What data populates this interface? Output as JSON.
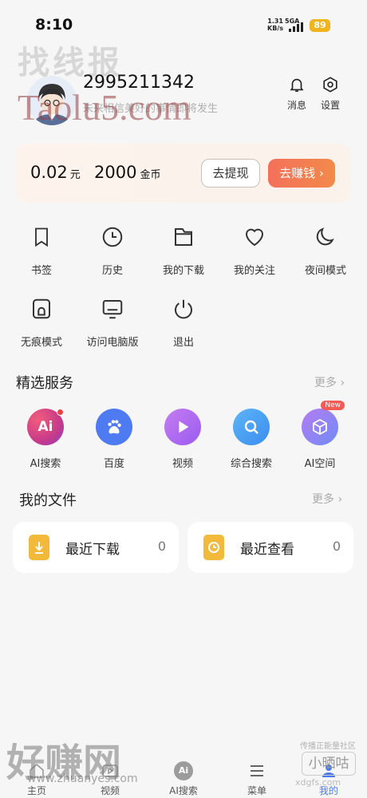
{
  "status": {
    "time": "8:10",
    "speed": "1.31",
    "speed_unit": "KB/s",
    "network": "5GA",
    "battery": "89"
  },
  "watermarks": {
    "top_cn": "找线报",
    "top_en": "Taolu5.com",
    "bottom_cn": "好赚网",
    "bottom_url": "www.zhuanyes.com",
    "corner_text": "传播正能量社区",
    "corner_logo": "小晒咕",
    "corner_url": "xdgfs.com"
  },
  "profile": {
    "uid": "2995211342",
    "subtitle": "未来相信美好的事情即将发生",
    "messages_label": "消息",
    "settings_label": "设置"
  },
  "wallet": {
    "balance": "0.02",
    "balance_unit": "元",
    "coins": "2000",
    "coins_unit": "金币",
    "withdraw_label": "去提现",
    "earn_label": "去赚钱"
  },
  "grid": [
    {
      "label": "书签",
      "icon": "bookmark-icon"
    },
    {
      "label": "历史",
      "icon": "clock-icon"
    },
    {
      "label": "我的下载",
      "icon": "folder-icon"
    },
    {
      "label": "我的关注",
      "icon": "heart-icon"
    },
    {
      "label": "夜间模式",
      "icon": "moon-icon"
    },
    {
      "label": "无痕模式",
      "icon": "ghost-icon"
    },
    {
      "label": "访问电脑版",
      "icon": "monitor-icon"
    },
    {
      "label": "退出",
      "icon": "power-icon"
    }
  ],
  "services": {
    "title": "精选服务",
    "more": "更多",
    "items": [
      {
        "label": "AI搜索",
        "glyph": "Ai",
        "color": "#e04f76"
      },
      {
        "label": "百度",
        "glyph": "",
        "color": "#4e7bf1"
      },
      {
        "label": "视频",
        "glyph": "",
        "color": "#a86cf2"
      },
      {
        "label": "综合搜索",
        "glyph": "",
        "color": "#4aa3f5"
      },
      {
        "label": "AI空间",
        "glyph": "",
        "color": "#8e7cf3",
        "badge": "New"
      }
    ]
  },
  "files": {
    "title": "我的文件",
    "more": "更多",
    "recent_download": "最近下载",
    "recent_download_count": "0",
    "recent_view": "最近查看",
    "recent_view_count": "0"
  },
  "tabbar": [
    {
      "label": "主页"
    },
    {
      "label": "视频"
    },
    {
      "label": "AI搜索"
    },
    {
      "label": "菜单"
    },
    {
      "label": "我的"
    }
  ]
}
